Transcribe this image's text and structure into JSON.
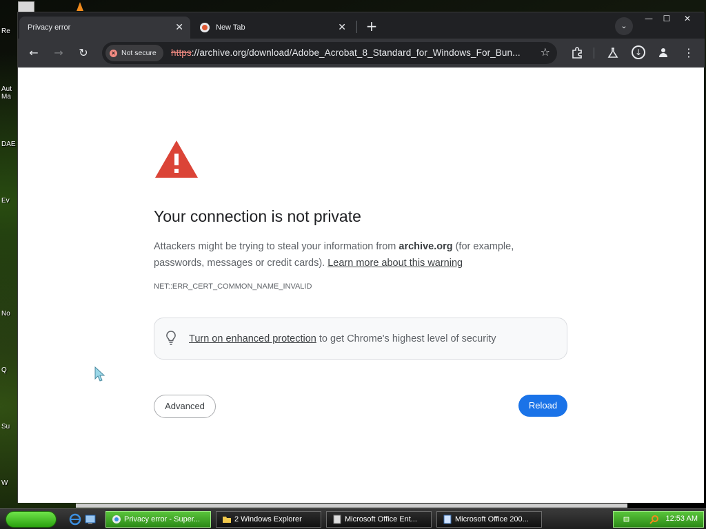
{
  "desktop": {
    "icon_labels": [
      "Re",
      "Aut\nMa",
      "DAE",
      "Ev",
      "No",
      "Q",
      "Su",
      "W"
    ]
  },
  "browser": {
    "tabs": [
      {
        "label": "Privacy error",
        "active": true
      },
      {
        "label": "New Tab",
        "active": false
      }
    ],
    "new_tab_symbol": "+",
    "window_controls": {
      "minimize": "—",
      "maximize": "☐",
      "close": "✕"
    },
    "toolbar": {
      "security_label": "Not secure",
      "url_scheme": "https",
      "url_rest": "://archive.org/download/Adobe_Acrobat_8_Standard_for_Windows_For_Bun..."
    }
  },
  "page": {
    "headline": "Your connection is not private",
    "desc_before": "Attackers might be trying to steal your information from ",
    "desc_domain": "archive.org",
    "desc_after": " (for example, passwords, messages or credit cards). ",
    "learn_more_link": "Learn more about this warning",
    "error_code": "NET::ERR_CERT_COMMON_NAME_INVALID",
    "enhanced_link": "Turn on enhanced protection",
    "enhanced_rest": " to get Chrome's highest level of security",
    "advanced_button": "Advanced",
    "reload_button": "Reload"
  },
  "taskbar": {
    "items": [
      {
        "label": "Privacy error - Super...",
        "active": true
      },
      {
        "label": "2 Windows Explorer",
        "active": false
      },
      {
        "label": "Microsoft Office Ent...",
        "active": false
      },
      {
        "label": "Microsoft Office 200...",
        "active": false
      }
    ],
    "clock": "12:53 AM"
  },
  "colors": {
    "warning_red": "#db4437",
    "reload_blue": "#1a73e8",
    "chrome_dark": "#202124",
    "toolbar_gray": "#35363a"
  }
}
